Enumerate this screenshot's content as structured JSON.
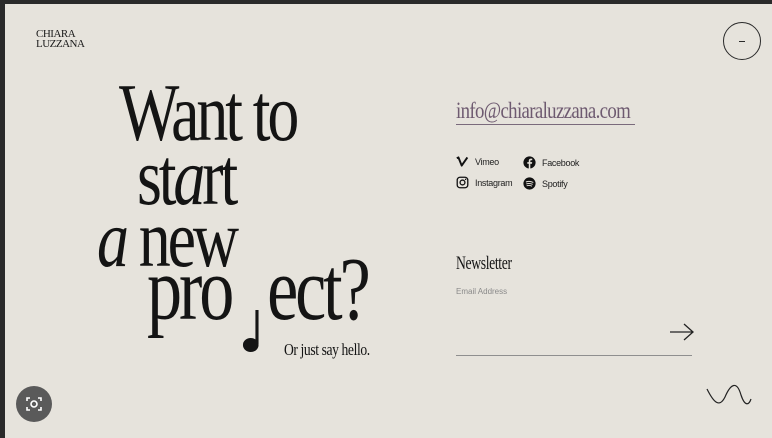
{
  "brand": {
    "logo_line1": "CHIARA",
    "logo_line2": "LUZZANA"
  },
  "hero": {
    "line1": "Want to",
    "line2_a": "st",
    "line2_b": "a",
    "line2_c": "rt",
    "line3_a": "a",
    "line3_b": " new",
    "line4_a": "pro",
    "line4_b": "ect?",
    "subtitle": "Or just say hello."
  },
  "contact": {
    "email": "info@chiaraluzzana.com"
  },
  "socials": [
    {
      "label": "Vimeo",
      "icon": "vimeo-icon"
    },
    {
      "label": "Facebook",
      "icon": "facebook-icon"
    },
    {
      "label": "Instagram",
      "icon": "instagram-icon"
    },
    {
      "label": "Spotify",
      "icon": "spotify-icon"
    }
  ],
  "newsletter": {
    "title": "Newsletter",
    "field_label": "Email Address",
    "value": ""
  },
  "colors": {
    "background": "#e6e3dc",
    "email_accent": "#6e5a70",
    "text": "#141414"
  }
}
